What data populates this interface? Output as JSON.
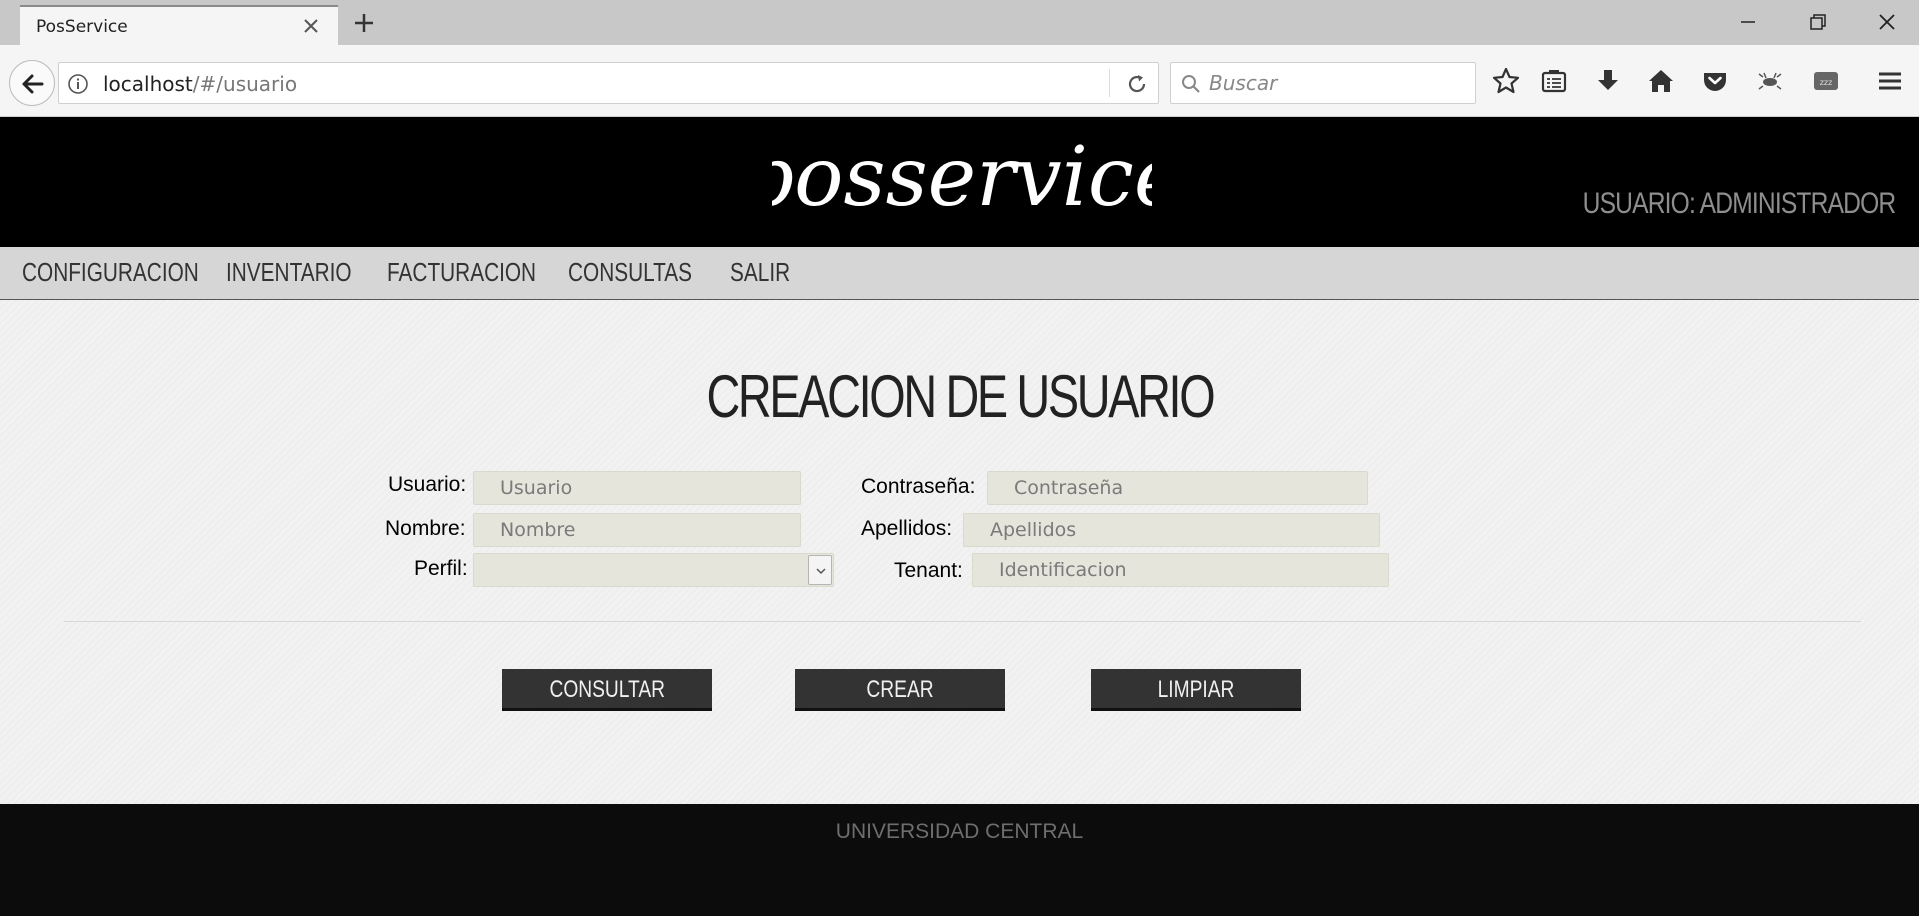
{
  "browser": {
    "tab_title": "PosService",
    "url_host": "localhost",
    "url_path": "/#/usuario",
    "search_placeholder": "Buscar"
  },
  "site": {
    "logo_text": "posservice",
    "user_label": "USUARIO: ADMINISTRADOR",
    "menu": [
      "CONFIGURACION",
      "INVENTARIO",
      "FACTURACION",
      "CONSULTAS",
      "SALIR"
    ],
    "footer_text": "UNIVERSIDAD CENTRAL"
  },
  "form": {
    "title": "CREACION DE USUARIO",
    "usuario_label": "Usuario:",
    "usuario_placeholder": "Usuario",
    "contrasena_label": "Contraseña:",
    "contrasena_placeholder": "Contraseña",
    "nombre_label": "Nombre:",
    "nombre_placeholder": "Nombre",
    "apellidos_label": "Apellidos:",
    "apellidos_placeholder": "Apellidos",
    "perfil_label": "Perfil:",
    "perfil_value": "",
    "tenant_label": "Tenant:",
    "tenant_placeholder": "Identificacion"
  },
  "buttons": {
    "consultar": "CONSULTAR",
    "crear": "CREAR",
    "limpiar": "LIMPIAR"
  }
}
